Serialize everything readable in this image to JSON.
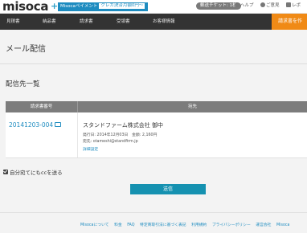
{
  "header": {
    "logo": "misoca",
    "plus": "+",
    "pay_badge": "Misocaペイメント",
    "pay_sub": "クレカ決済月額0円〜",
    "ticket": "郵送チケット: 1枚",
    "help": "ヘルプ",
    "feedback": "ご意見",
    "report": "レポ"
  },
  "nav": {
    "items": [
      "見積書",
      "納品書",
      "請求書",
      "受領書",
      "お客様情報"
    ],
    "cta": "請求書を作"
  },
  "page": {
    "title": "メール配信",
    "section_title": "配信先一覧"
  },
  "table": {
    "headers": [
      "請求書番号",
      "宛先"
    ],
    "rows": [
      {
        "invoice_no": "20141203-004",
        "recipient": "スタンドファーム株式会社 御中",
        "meta": "発行日: 2014年12月03日　金額: 2,160円",
        "email": "宛先: otameshi@standfirm.jp",
        "detail": "詳細設定"
      }
    ]
  },
  "form": {
    "cc_label": "自分宛てにもccを送る",
    "send_label": "送信"
  },
  "footer": {
    "links": [
      "Misocaについて",
      "料金",
      "FAQ",
      "特定商取引法に基づく表記",
      "利用規約",
      "プライバシーポリシー",
      "運営会社",
      "Misoca"
    ]
  },
  "colors": {
    "accent": "#1e8cc0",
    "nav_bg": "#333333",
    "cta": "#f08a16",
    "send": "#1591b0"
  }
}
